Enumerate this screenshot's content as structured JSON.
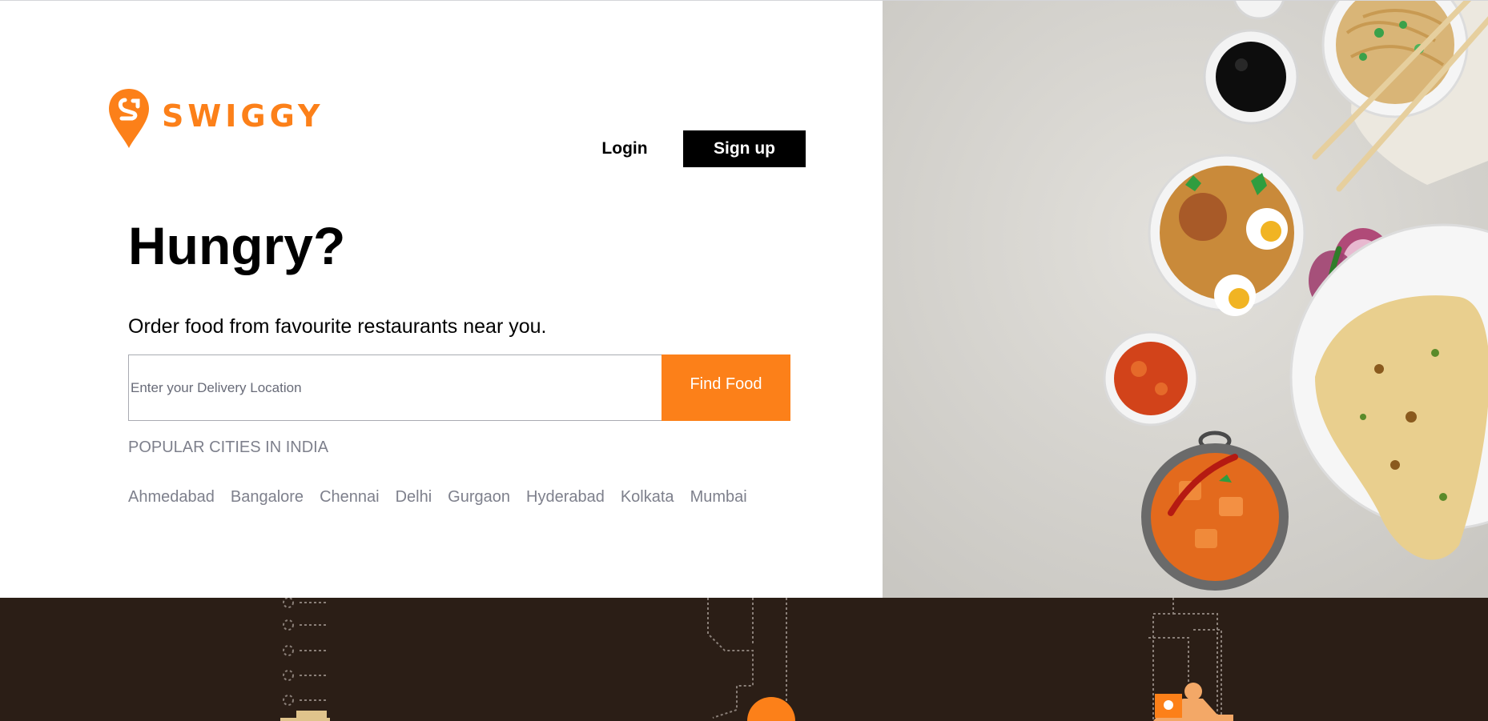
{
  "brand": {
    "name": "SWIGGY",
    "color": "#fc8019",
    "logo_icon": "swiggy-pin-logo"
  },
  "header": {
    "login_label": "Login",
    "signup_label": "Sign up"
  },
  "hero": {
    "title": "Hungry?",
    "subtitle": "Order food from favourite restaurants near you."
  },
  "search": {
    "placeholder": "Enter your Delivery Location",
    "value": "",
    "button_label": "Find Food",
    "button_color": "#fc8019"
  },
  "cities": {
    "title": "POPULAR CITIES IN INDIA",
    "items": [
      "Ahmedabad",
      "Bangalore",
      "Chennai",
      "Delhi",
      "Gurgaon",
      "Hyderabad",
      "Kolkata",
      "Mumbai"
    ]
  },
  "colors": {
    "dark_band": "#2b1e16",
    "food_background": "#d7d5d0"
  }
}
